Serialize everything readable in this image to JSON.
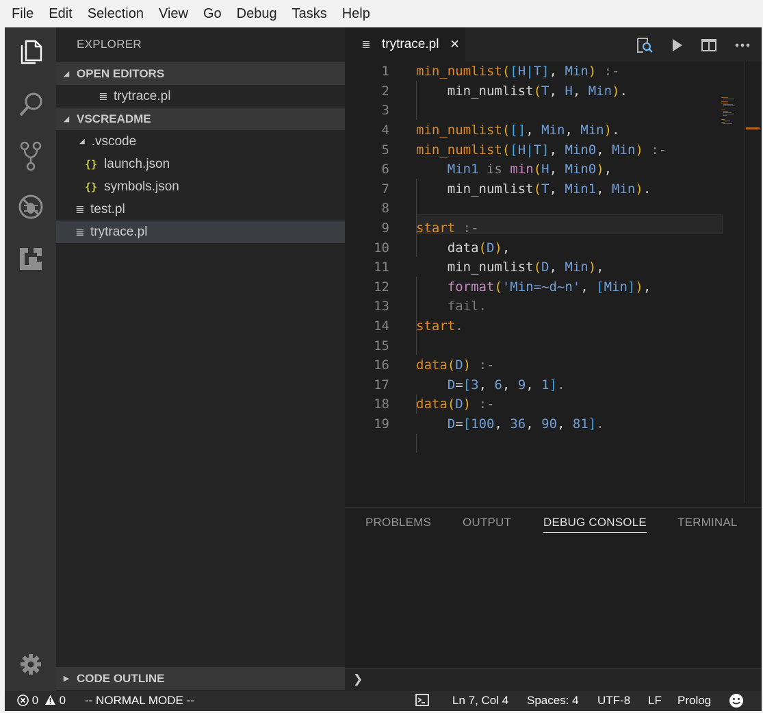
{
  "menu": [
    "File",
    "Edit",
    "Selection",
    "View",
    "Go",
    "Debug",
    "Tasks",
    "Help"
  ],
  "sidebar": {
    "title": "EXPLORER",
    "open_editors_header": "OPEN EDITORS",
    "open_editors": [
      {
        "label": "trytrace.pl",
        "icon": "lines-file-icon"
      }
    ],
    "folder_header": "VSCREADME",
    "tree": [
      {
        "label": ".vscode",
        "icon": "folder-open-twisty"
      },
      {
        "label": "launch.json",
        "icon": "json-braces-icon"
      },
      {
        "label": "symbols.json",
        "icon": "json-braces-icon"
      },
      {
        "label": "test.pl",
        "icon": "lines-file-icon"
      },
      {
        "label": "trytrace.pl",
        "icon": "lines-file-icon",
        "selected": true
      }
    ],
    "outline_header": "CODE OUTLINE"
  },
  "editor": {
    "tab": {
      "label": "trytrace.pl",
      "close": "✕"
    },
    "toolbar_icons": [
      "search-preview-icon",
      "run-icon",
      "split-editor-icon",
      "more-actions-icon"
    ],
    "line_numbers": [
      "1",
      "2",
      "3",
      "4",
      "5",
      "6",
      "7",
      "8",
      "9",
      "10",
      "11",
      "12",
      "13",
      "14",
      "15",
      "16",
      "17",
      "18",
      "19"
    ],
    "cursor_line": 7
  },
  "panel": {
    "tabs": [
      "PROBLEMS",
      "OUTPUT",
      "DEBUG CONSOLE",
      "TERMINAL"
    ],
    "active_tab": "DEBUG CONSOLE",
    "prompt": "❯"
  },
  "status": {
    "errors": "0",
    "warnings": "0",
    "mode": "-- NORMAL MODE --",
    "position": "Ln 7, Col 4",
    "spaces": "Spaces: 4",
    "encoding": "UTF-8",
    "eol": "LF",
    "language": "Prolog"
  },
  "colors": {
    "activity_bar": "#333333",
    "sidebar": "#252526",
    "editor": "#1e1e1e",
    "status_bar": "#2c2c2c",
    "function": "#e08a1e",
    "variable": "#6f9fd8",
    "paren": "#e6b422",
    "bracket": "#3ba7e6"
  }
}
